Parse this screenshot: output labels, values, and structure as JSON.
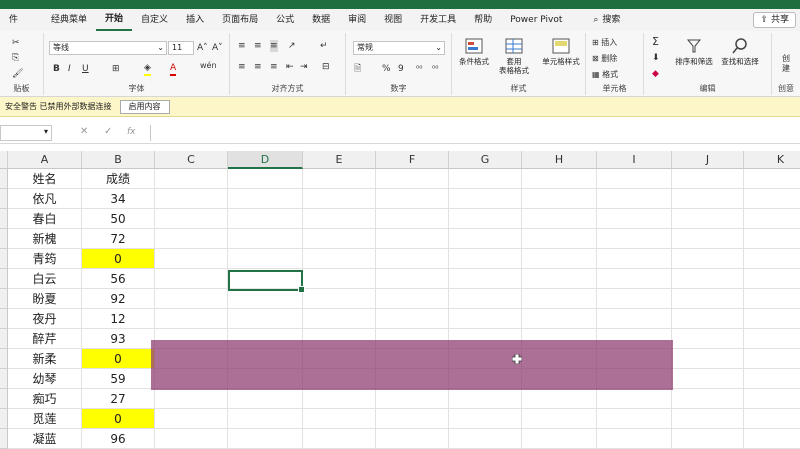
{
  "tabs": [
    "件",
    "经典菜单",
    "开始",
    "自定义",
    "插入",
    "页面布局",
    "公式",
    "数据",
    "审阅",
    "视图",
    "开发工具",
    "帮助",
    "Power Pivot",
    "搜索"
  ],
  "active_tab": "开始",
  "share_label": "共享",
  "ribbon": {
    "clipboard": {
      "label": "贴板"
    },
    "font": {
      "name": "等线",
      "size": "11",
      "grow": "A",
      "shrink": "A",
      "bold": "B",
      "italic": "I",
      "underline": "U",
      "wen": "wén",
      "label": "字体"
    },
    "alignment": {
      "label": "对齐方式"
    },
    "number": {
      "format": "常规",
      "percent": "%",
      "comma": "9",
      "label": "数字"
    },
    "styles": {
      "conditional": "条件格式",
      "table_line1": "套用",
      "table_line2": "表格格式",
      "cell_styles": "单元格样式",
      "label": "样式"
    },
    "cells": {
      "insert": "插入",
      "delete": "删除",
      "format": "格式",
      "label": "单元格"
    },
    "editing": {
      "sigma": "Σ",
      "sort": "排序和筛选",
      "find": "查找和选择",
      "label": "编辑"
    },
    "create": {
      "label_top": "创",
      "label_mid": "建",
      "label": "创意"
    }
  },
  "message_bar": {
    "text": "安全警告  已禁用外部数据连接",
    "button": "启用内容"
  },
  "formula_bar": {
    "fx": "fx"
  },
  "columns": [
    "A",
    "B",
    "C",
    "D",
    "E",
    "F",
    "G",
    "H",
    "I",
    "J",
    "K"
  ],
  "selected_column": "D",
  "rows": [
    {
      "name": "姓名",
      "score": "成绩",
      "highlight": false
    },
    {
      "name": "依凡",
      "score": "34",
      "highlight": false
    },
    {
      "name": "春白",
      "score": "50",
      "highlight": false
    },
    {
      "name": "新槐",
      "score": "72",
      "highlight": false
    },
    {
      "name": "青筠",
      "score": "0",
      "highlight": true
    },
    {
      "name": "白云",
      "score": "56",
      "highlight": false
    },
    {
      "name": "盼夏",
      "score": "92",
      "highlight": false
    },
    {
      "name": "夜丹",
      "score": "12",
      "highlight": false
    },
    {
      "name": "醉芹",
      "score": "93",
      "highlight": false
    },
    {
      "name": "新柔",
      "score": "0",
      "highlight": true
    },
    {
      "name": "幼琴",
      "score": "59",
      "highlight": false
    },
    {
      "name": "痴巧",
      "score": "27",
      "highlight": false
    },
    {
      "name": "觅莲",
      "score": "0",
      "highlight": true
    },
    {
      "name": "凝蓝",
      "score": "96",
      "highlight": false
    }
  ],
  "colors": {
    "accent": "#217346",
    "highlight": "#ffff00",
    "overlay": "#8c376e"
  }
}
